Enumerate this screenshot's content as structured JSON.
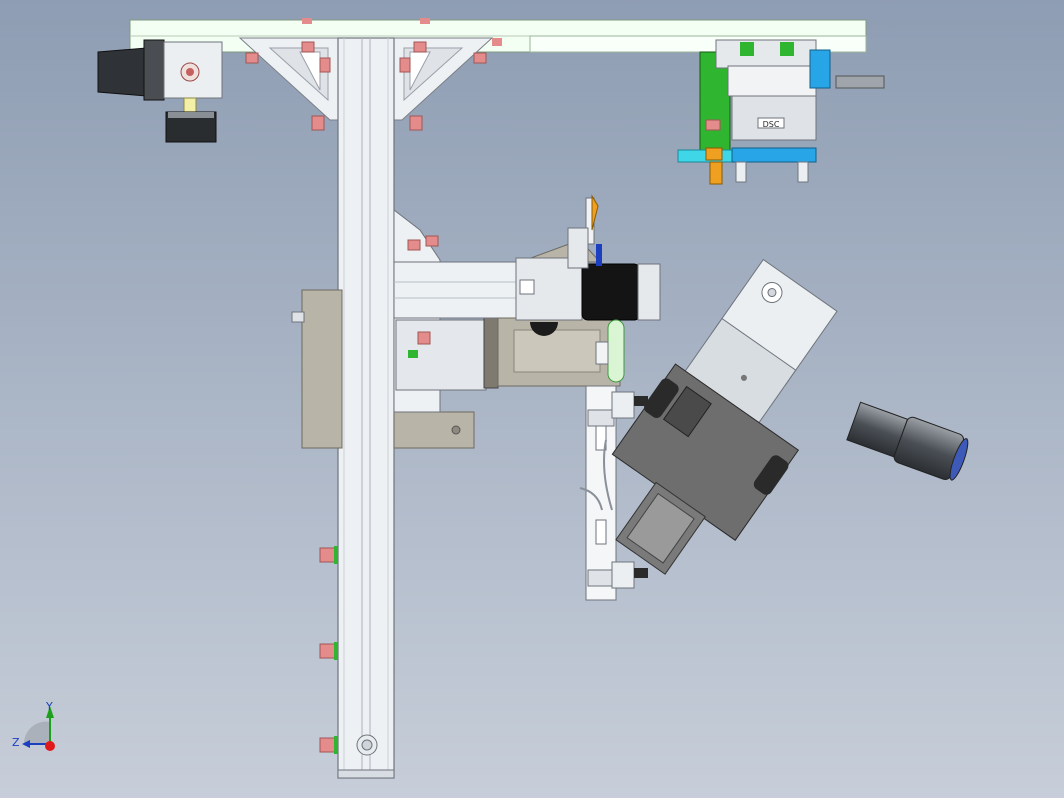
{
  "viewport": {
    "background_top": "#8e9db3",
    "background_bottom": "#c7ced9"
  },
  "triad": {
    "y_label": "Y",
    "z_label": "Z",
    "x_axis_color": "#e01a1a",
    "y_axis_color": "#1aa01a",
    "z_axis_color": "#1c3fbf"
  },
  "palette": {
    "profile": "#eef1f4",
    "profile_edge": "#8a9099",
    "top_beam": "#f2fff2",
    "gray_plate": "#b8b4a8",
    "cylinder_green": "#2fb52f",
    "cylinder_blue": "#27a5e6",
    "cylinder_cyan": "#3fd6e8",
    "dark_body": "#6e6e6e",
    "black_block": "#141414",
    "bolt_red": "#e48b8b",
    "orange": "#f0a020"
  },
  "labels": {
    "cylinder_marking": "DSC"
  }
}
